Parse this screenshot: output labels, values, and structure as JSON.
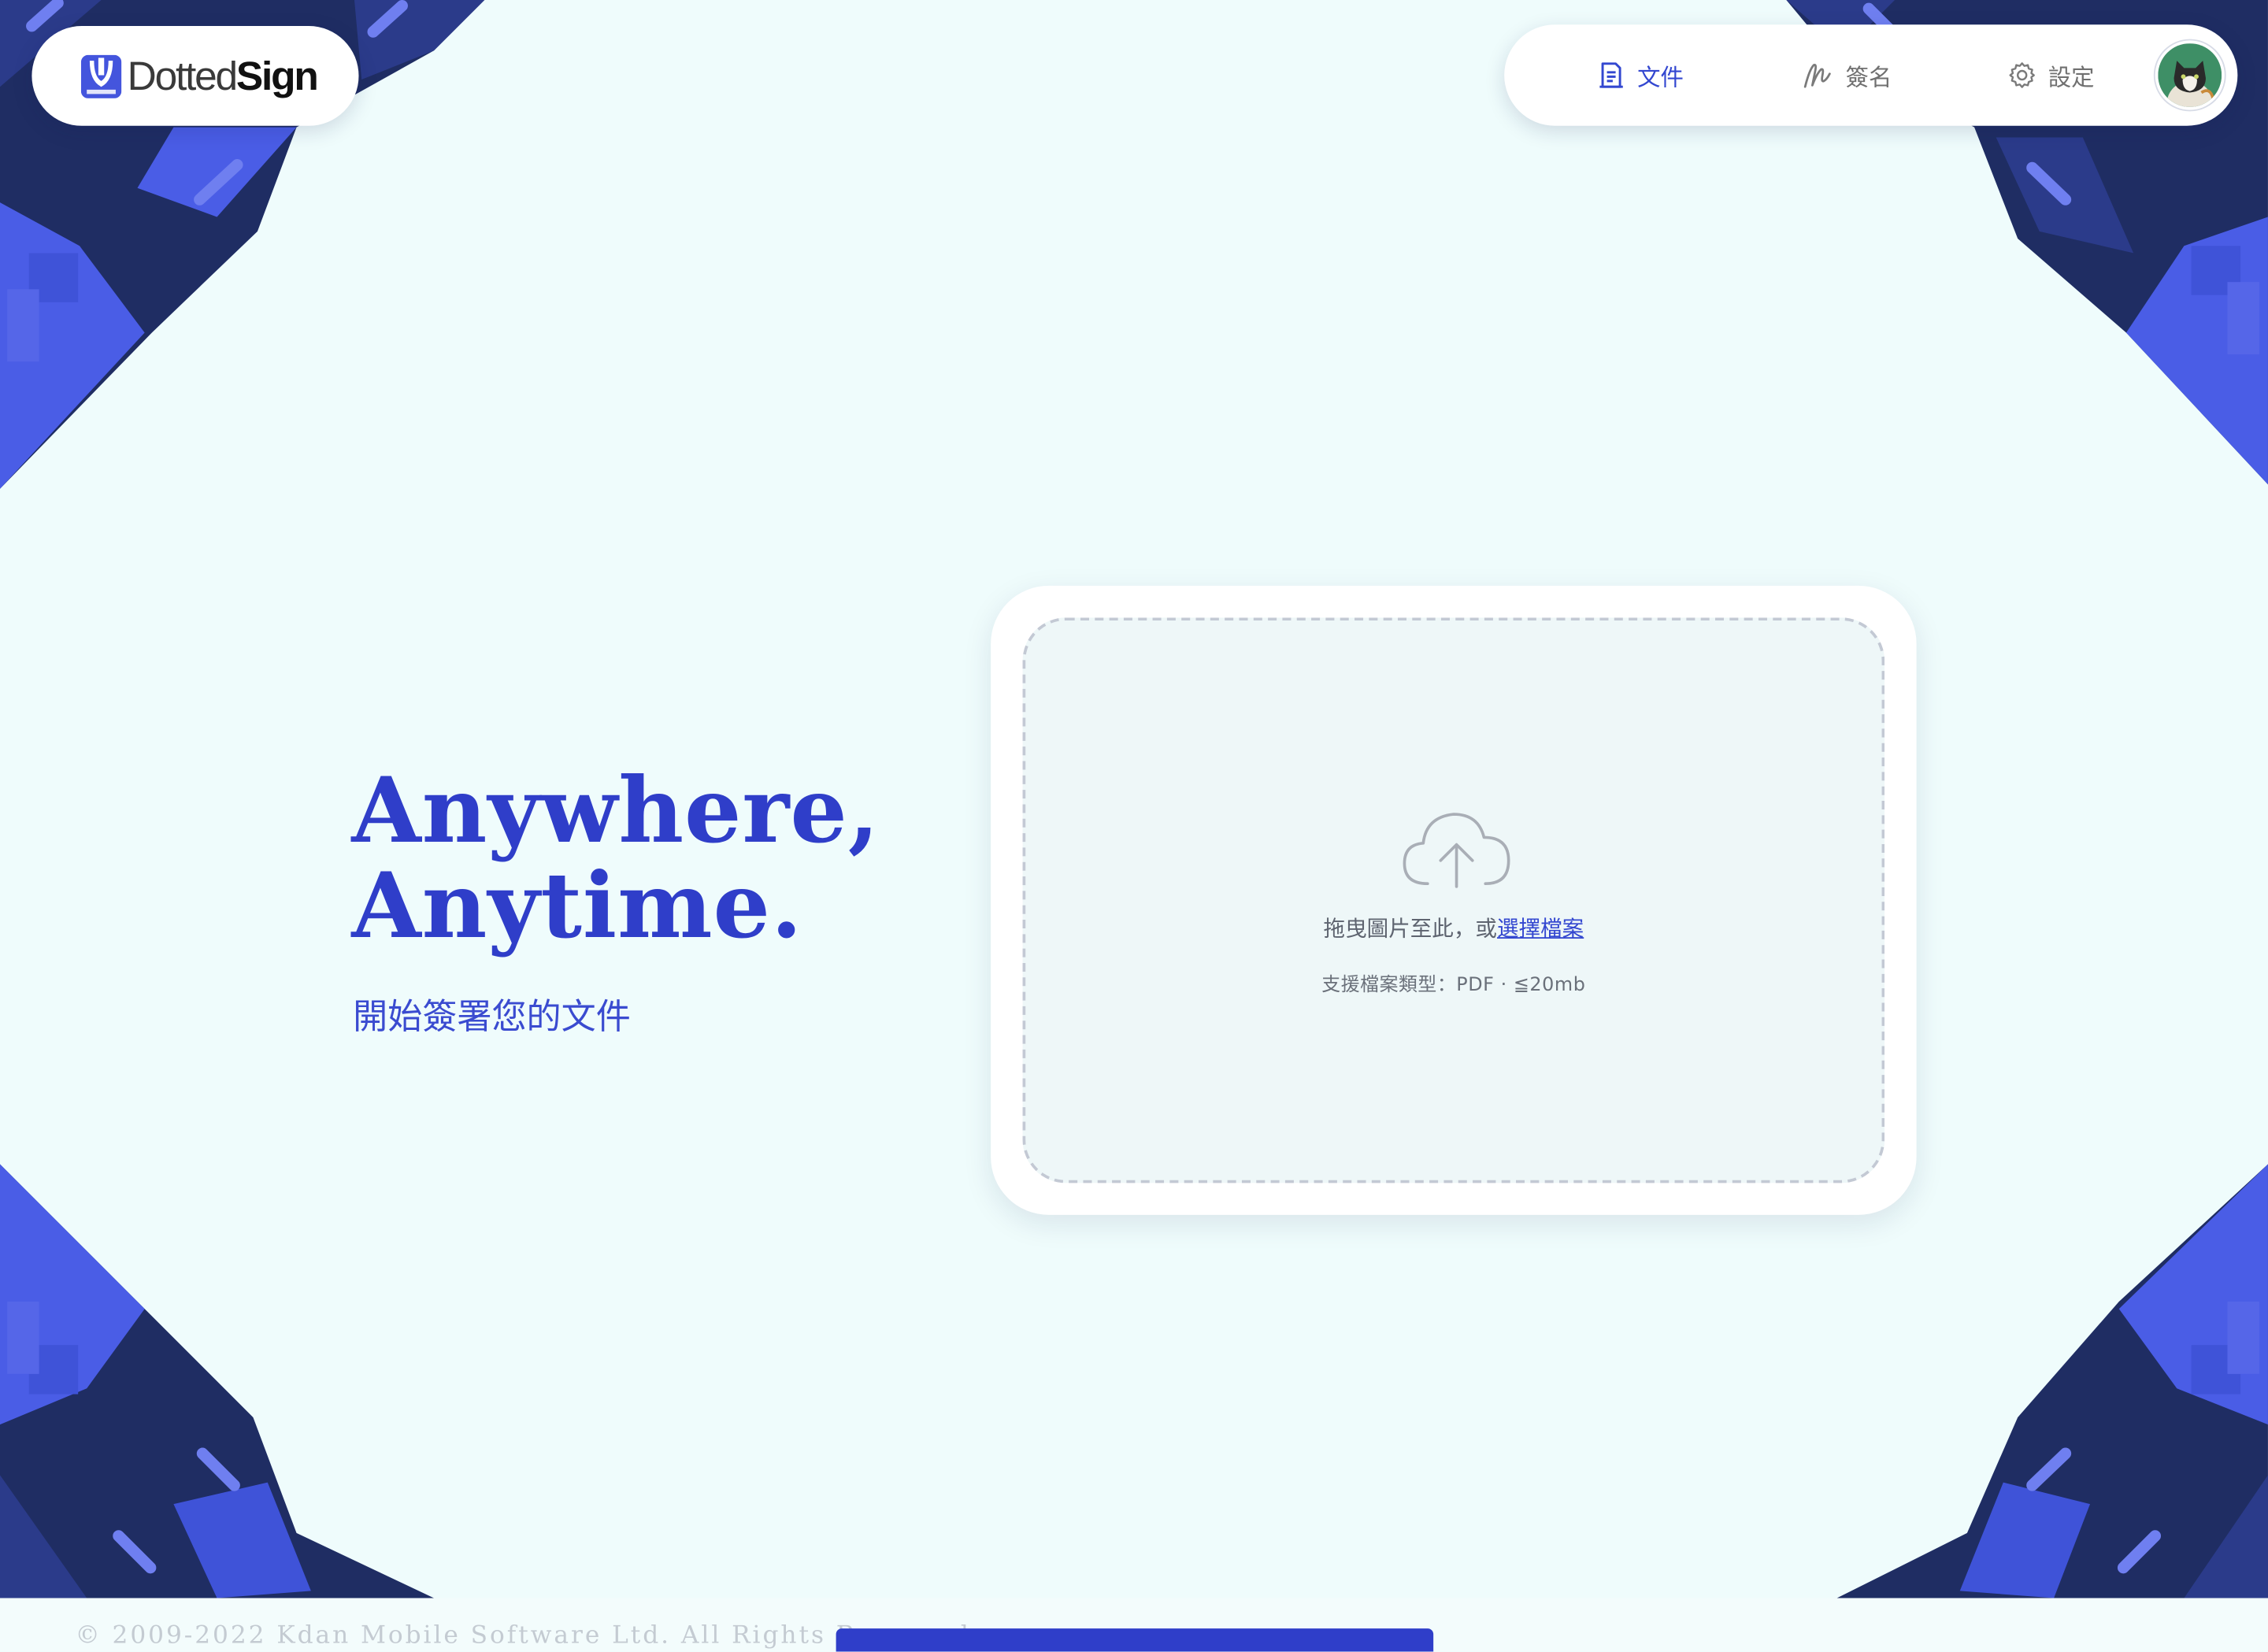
{
  "app": {
    "logo_text_light": "Dotted",
    "logo_text_bold": "Sign"
  },
  "nav": {
    "items": [
      {
        "label": "文件",
        "icon": "document-icon",
        "active": true
      },
      {
        "label": "簽名",
        "icon": "signature-icon",
        "active": false
      },
      {
        "label": "設定",
        "icon": "gear-icon",
        "active": false
      }
    ],
    "avatar_icon": "user-avatar"
  },
  "hero": {
    "title_line1": "Anywhere,",
    "title_line2": "Anytime.",
    "subtitle": "開始簽署您的文件"
  },
  "upload": {
    "icon": "cloud-upload-icon",
    "drop_text": "拖曳圖片至此，或",
    "choose_link": "選擇檔案",
    "support_text": "支援檔案類型：PDF · ≦20mb"
  },
  "footer": {
    "copyright": "© 2009-2022 Kdan Mobile Software Ltd. All Rights Reserved."
  },
  "colors": {
    "accent": "#3347d0",
    "title": "#2f3ec9",
    "background": "#effcfc",
    "corner_dark": "#1f2d63",
    "corner_bright": "#4a5de6"
  }
}
